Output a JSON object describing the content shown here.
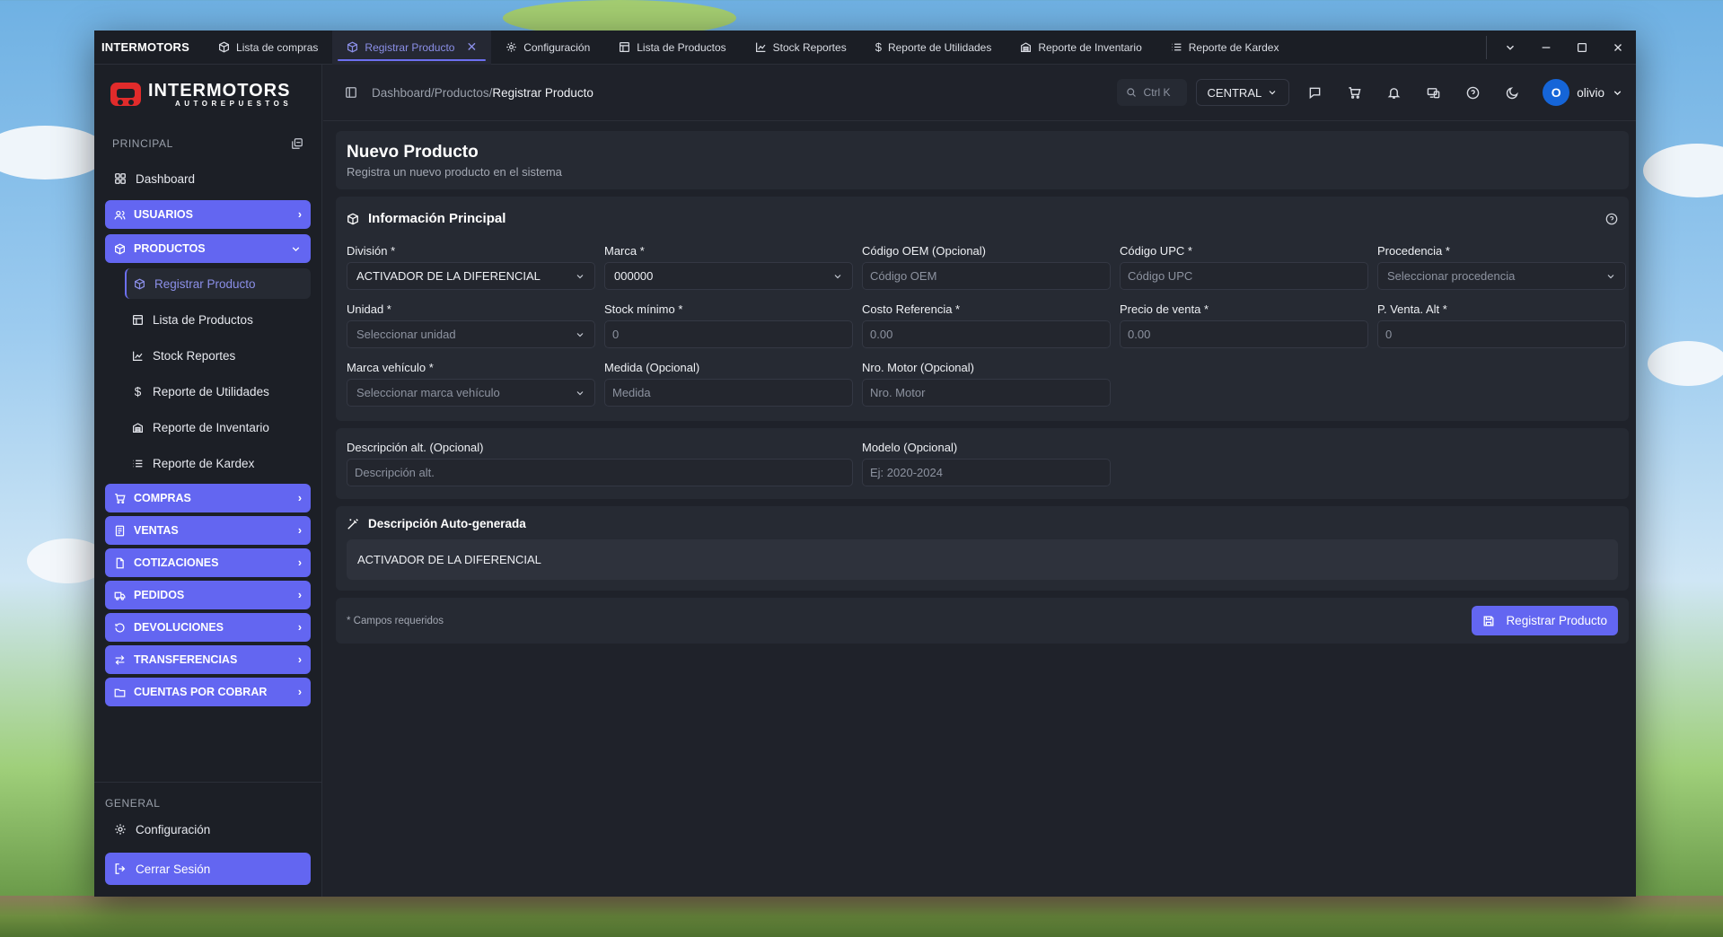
{
  "app": {
    "name": "INTERMOTORS"
  },
  "tabs": [
    {
      "label": "Lista de compras",
      "icon": "box-icon"
    },
    {
      "label": "Registrar Producto",
      "icon": "box-icon",
      "active": true
    },
    {
      "label": "Configuración",
      "icon": "gear-icon"
    },
    {
      "label": "Lista de Productos",
      "icon": "table-icon"
    },
    {
      "label": "Stock Reportes",
      "icon": "chart-icon"
    },
    {
      "label": "Reporte de Utilidades",
      "icon": "dollar-icon"
    },
    {
      "label": "Reporte de Inventario",
      "icon": "warehouse-icon"
    },
    {
      "label": "Reporte de Kardex",
      "icon": "list-icon"
    }
  ],
  "logo": {
    "primary": "INTERMOTORS",
    "secondary": "AUTOREPUESTOS"
  },
  "sidebar": {
    "principal_title": "PRINCIPAL",
    "dashboard": "Dashboard",
    "usuarios": "USUARIOS",
    "productos": "PRODUCTOS",
    "productos_items": [
      {
        "label": "Registrar Producto",
        "active": true
      },
      {
        "label": "Lista de Productos"
      },
      {
        "label": "Stock Reportes"
      },
      {
        "label": "Reporte de Utilidades"
      },
      {
        "label": "Reporte de Inventario"
      },
      {
        "label": "Reporte de Kardex"
      }
    ],
    "groups": [
      "COMPRAS",
      "VENTAS",
      "COTIZACIONES",
      "PEDIDOS",
      "DEVOLUCIONES",
      "TRANSFERENCIAS",
      "CUENTAS POR COBRAR"
    ],
    "general_title": "GENERAL",
    "configuracion": "Configuración",
    "logout": "Cerrar Sesión"
  },
  "header": {
    "breadcrumb_path": "Dashboard/Productos/",
    "breadcrumb_current": "Registrar Producto",
    "search_placeholder": "Ctrl K",
    "branch": "CENTRAL",
    "user_initial": "O",
    "user_name": "olivio"
  },
  "page": {
    "title": "Nuevo Producto",
    "subtitle": "Registra un nuevo producto en el sistema"
  },
  "main_info": {
    "title": "Información Principal",
    "fields": {
      "division": {
        "label": "División *",
        "value": "ACTIVADOR DE LA DIFERENCIAL"
      },
      "marca": {
        "label": "Marca *",
        "value": "000000"
      },
      "codigo_oem": {
        "label": "Código OEM (Opcional)",
        "placeholder": "Código OEM"
      },
      "codigo_upc": {
        "label": "Código UPC *",
        "placeholder": "Código UPC"
      },
      "procedencia": {
        "label": "Procedencia *",
        "placeholder": "Seleccionar procedencia"
      },
      "unidad": {
        "label": "Unidad *",
        "placeholder": "Seleccionar unidad"
      },
      "stock_minimo": {
        "label": "Stock mínimo *",
        "placeholder": "0"
      },
      "costo_referencia": {
        "label": "Costo Referencia *",
        "placeholder": "0.00"
      },
      "precio_venta": {
        "label": "Precio de venta *",
        "placeholder": "0.00"
      },
      "p_venta_alt": {
        "label": "P. Venta. Alt *",
        "placeholder": "0"
      },
      "marca_vehiculo": {
        "label": "Marca vehículo *",
        "placeholder": "Seleccionar marca vehículo"
      },
      "medida": {
        "label": "Medida (Opcional)",
        "placeholder": "Medida"
      },
      "nro_motor": {
        "label": "Nro. Motor (Opcional)",
        "placeholder": "Nro. Motor"
      }
    }
  },
  "extra": {
    "descripcion_alt": {
      "label": "Descripción alt. (Opcional)",
      "placeholder": "Descripción alt."
    },
    "modelo": {
      "label": "Modelo (Opcional)",
      "placeholder": "Ej: 2020-2024"
    }
  },
  "auto_desc": {
    "title": "Descripción Auto-generada",
    "value": "ACTIVADOR DE LA DIFERENCIAL"
  },
  "footer": {
    "note": "* Campos requeridos",
    "submit": "Registrar Producto"
  },
  "colors": {
    "accent": "#6366f1",
    "bg": "#1f222a",
    "card": "#262a33",
    "avatar": "#1565d8"
  }
}
